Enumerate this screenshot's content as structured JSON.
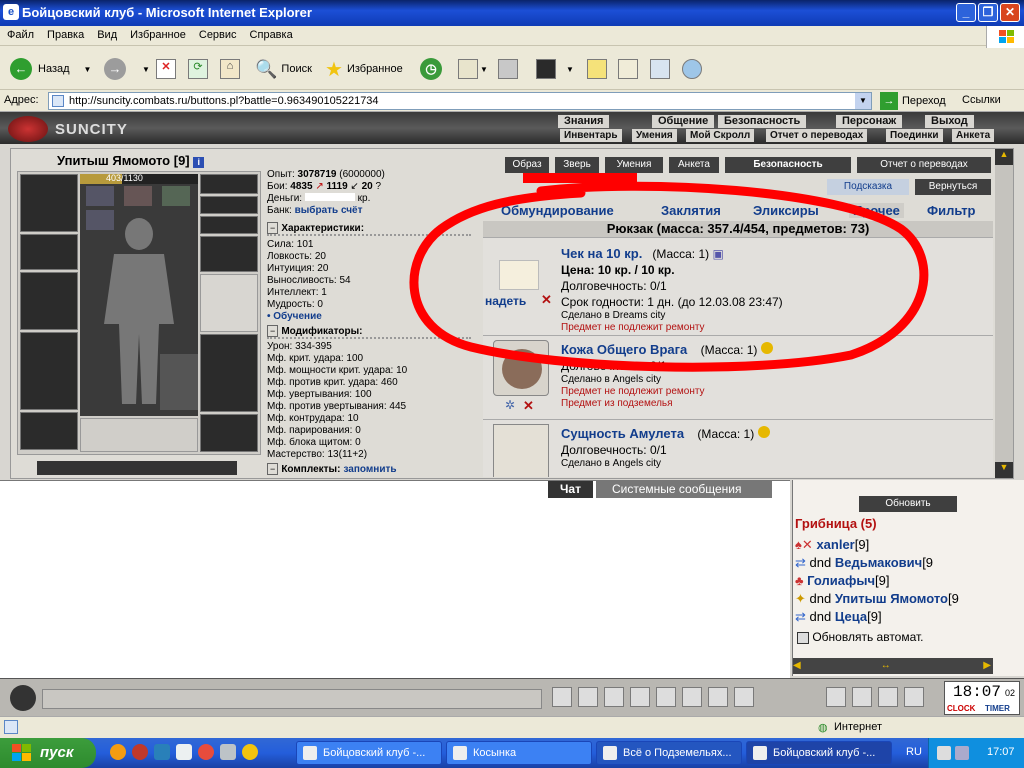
{
  "window": {
    "title": "Бойцовский клуб - Microsoft Internet Explorer"
  },
  "menu": [
    "Файл",
    "Правка",
    "Вид",
    "Избранное",
    "Сервис",
    "Справка"
  ],
  "toolbar": {
    "back": "Назад",
    "search": "Поиск",
    "favorites": "Избранное"
  },
  "address": {
    "label": "Адрес:",
    "url": "http://suncity.combats.ru/buttons.pl?battle=0.963490105221734",
    "go": "Переход",
    "links": "Ссылки"
  },
  "site": {
    "logo": "SUNCITY",
    "nav_top": [
      "Знания",
      "Общение",
      "Безопасность",
      "Персонаж",
      "Выход"
    ],
    "nav_bottom": [
      "Инвентарь",
      "Умения",
      "Мой Скролл",
      "Отчет о переводах",
      "Поединки",
      "Анкета"
    ]
  },
  "character": {
    "name": "Упитыш Ямомото",
    "level": "[9]",
    "hp": "403/1130",
    "exp_label": "Опыт:",
    "exp": "3078719",
    "exp_next": "(6000000)",
    "fights_label": "Бои:",
    "wins": "4835",
    "losses": "1119",
    "draws": "20",
    "money_label": "Деньги:",
    "money_unit": "кр.",
    "bank_label": "Банк:",
    "bank_link": "выбрать счёт"
  },
  "stats": {
    "header": "Характеристики:",
    "rows": [
      "Сила: 101",
      "Ловкость: 20",
      "Интуиция: 20",
      "Выносливость: 54",
      "Интеллект: 1",
      "Мудрость: 0"
    ],
    "training": "• Обучение"
  },
  "mods": {
    "header": "Модификаторы:",
    "rows": [
      "Урон: 334-395",
      "Мф. крит. удара: 100",
      "Мф. мощности крит. удара: 10",
      "Мф. против крит. удара: 460",
      "Мф. увертывания: 100",
      "Мф. против увертывания: 445",
      "Мф. контрудара: 10",
      "Мф. парирования: 0",
      "Мф. блока щитом: 0",
      "Мастерство: 13(11+2)"
    ]
  },
  "sets": {
    "header": "Комплекты:",
    "remember": "запомнить"
  },
  "top_buttons": [
    "Образ",
    "Зверь",
    "Умения",
    "Анкета",
    "Безопасность",
    "Отчет о переводах"
  ],
  "hint_buttons": [
    "Подсказка",
    "Вернуться"
  ],
  "tabs": [
    "Обмундирование",
    "Заклятия",
    "Эликсиры",
    "Прочее",
    "Фильтр"
  ],
  "backpack": "Рюкзак (масса: 357.4/454, предметов: 73)",
  "items": [
    {
      "name": "Чек на 10 кр.",
      "mass": "(Масса: 1)",
      "price": "Цена: 10 кр. / 10 кр.",
      "durability": "Долговечность: 0/1",
      "expiry": "Срок годности: 1 дн. (до 12.03.08 23:47)",
      "made": "Сделано в Dreams city",
      "note": "Предмет не подлежит ремонту",
      "wear": "надеть"
    },
    {
      "name": "Кожа Общего Врага",
      "mass": "(Масса: 1)",
      "durability": "Долговечность: 0/1",
      "made": "Сделано в Angels city",
      "note": "Предмет не подлежит ремонту",
      "note2": "Предмет из подземелья"
    },
    {
      "name": "Сущность Амулета",
      "mass": "(Масса: 1)",
      "durability": "Долговечность: 0/1",
      "made": "Сделано в Angels city"
    }
  ],
  "chat": {
    "tab_chat": "Чат",
    "tab_system": "Системные сообщения"
  },
  "online": {
    "refresh": "Обновить",
    "room": "Грибница (5)",
    "users": [
      {
        "prefix": "",
        "name": "xanler",
        "level": "[9]"
      },
      {
        "prefix": "dnd ",
        "name": "Ведьмакович",
        "level": "[9"
      },
      {
        "prefix": "",
        "name": "Голиафыч",
        "level": "[9]"
      },
      {
        "prefix": "dnd ",
        "name": "Упитыш Ямомото",
        "level": "[9"
      },
      {
        "prefix": "dnd ",
        "name": "Цеца",
        "level": "[9]"
      }
    ],
    "auto": "Обновлять автомат."
  },
  "clock": {
    "time": "18:07",
    "sec": "02",
    "clock_label": "CLOCK",
    "timer_label": "TIMER"
  },
  "statusbar": {
    "zone": "Интернет"
  },
  "taskbar": {
    "start": "пуск",
    "tasks": [
      "Бойцовский клуб -...",
      "Косынка",
      "Всё о Подземельях...",
      "Бойцовский клуб -..."
    ],
    "lang": "RU",
    "time": "17:07"
  },
  "colors": {
    "accent_red": "#ff0000",
    "link_blue": "#123d8c",
    "site_bg": "#d8d6d1",
    "xp_blue": "#245edb"
  }
}
